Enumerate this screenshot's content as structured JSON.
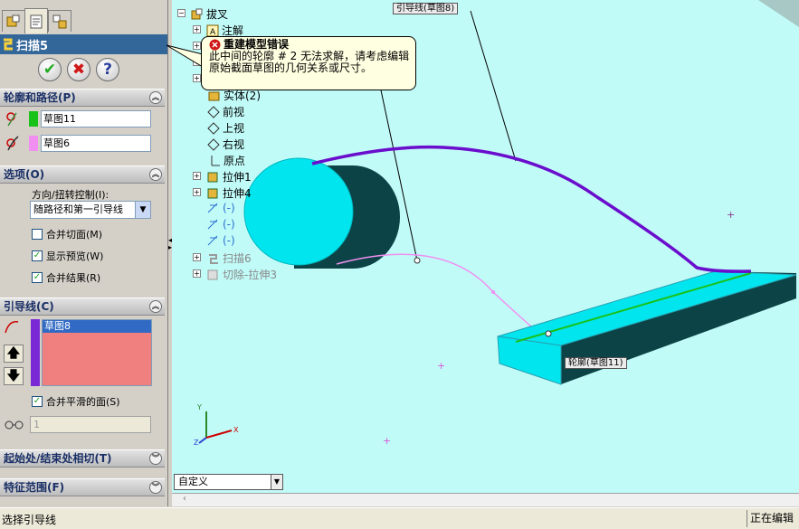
{
  "property_manager": {
    "title": "扫描5",
    "tabs": [
      "feature-manager-icon",
      "property-manager-icon",
      "configuration-manager-icon"
    ],
    "buttons": {
      "ok": "✔",
      "cancel": "✖",
      "help": "?"
    },
    "groups": {
      "profile_path": {
        "header": "轮廓和路径(P)",
        "profile": {
          "value": "草图11",
          "color": "#19c219"
        },
        "path": {
          "value": "草图6",
          "color": "#f08ff0"
        }
      },
      "options": {
        "header": "选项(O)",
        "orientation_label": "方向/扭转控制(I):",
        "orientation_value": "随路径和第一引导线",
        "checkboxes": [
          {
            "label": "合并切面(M)",
            "checked": false
          },
          {
            "label": "显示预览(W)",
            "checked": true
          },
          {
            "label": "合并结果(R)",
            "checked": true
          }
        ]
      },
      "guides": {
        "header": "引导线(C)",
        "items": [
          "草图8"
        ],
        "merge_smooth": {
          "label": "合并平滑的面(S)",
          "checked": true
        },
        "value": "1"
      },
      "tangency": {
        "header": "起始处/结束处相切(T)"
      },
      "feature_scope": {
        "header": "特征范围(F)"
      }
    }
  },
  "tree": {
    "root": "拔叉",
    "items": [
      {
        "label": "注解",
        "style": "normal"
      },
      {
        "label": "实体(2)",
        "style": "normal"
      },
      {
        "label": "前视",
        "style": "normal"
      },
      {
        "label": "上视",
        "style": "normal"
      },
      {
        "label": "右视",
        "style": "normal"
      },
      {
        "label": "原点",
        "style": "normal"
      },
      {
        "label": "拉伸1",
        "style": "normal"
      },
      {
        "label": "拉伸4",
        "style": "normal"
      },
      {
        "label": "(-)",
        "style": "blue"
      },
      {
        "label": "(-)",
        "style": "blue"
      },
      {
        "label": "(-)",
        "style": "blue"
      },
      {
        "label": "扫描6",
        "style": "gray"
      },
      {
        "label": "切除-拉伸3",
        "style": "gray"
      }
    ]
  },
  "tooltip": {
    "title": "重建模型错误",
    "message": "此中间的轮廓 # 2 无法求解，请考虑编辑原始截面草图的几何关系或尺寸。"
  },
  "callouts": {
    "guide": "引导线(草图8)",
    "profile": "轮廓(草图11)"
  },
  "view_combo": "自定义",
  "status": {
    "left": "选择引导线",
    "right": "正在编辑"
  },
  "colors": {
    "viewport_bg": "#c1fbf8",
    "cyan_solid": "#00e5ee",
    "guide_curve": "#6a0dcc",
    "path_curve": "#f08ff0"
  }
}
